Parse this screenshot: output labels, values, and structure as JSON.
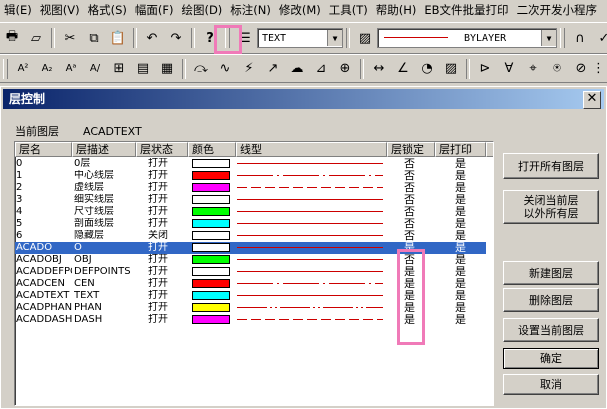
{
  "menubar": [
    "辑(E)",
    "视图(V)",
    "格式(S)",
    "幅面(F)",
    "绘图(D)",
    "标注(N)",
    "修改(M)",
    "工具(T)",
    "帮助(H)",
    "EB文件批量打印",
    "二次开发小程序"
  ],
  "toolbar1": {
    "layer_combo": "TEXT",
    "linetype_combo": "BYLAYER"
  },
  "dialog": {
    "title": "层控制",
    "current_layer_label": "当前图层",
    "current_layer_value": "ACADTEXT",
    "columns": [
      "层名",
      "层描述",
      "层状态",
      "颜色",
      "线型",
      "层锁定",
      "层打印"
    ],
    "rows": [
      {
        "name": "0",
        "desc": "0层",
        "state": "打开",
        "color": "#ffffff",
        "ltype": "solid",
        "lock": "否",
        "print": "是"
      },
      {
        "name": "1",
        "desc": "中心线层",
        "state": "打开",
        "color": "#ff0000",
        "ltype": "center",
        "lock": "否",
        "print": "是"
      },
      {
        "name": "2",
        "desc": "虚线层",
        "state": "打开",
        "color": "#ff00ff",
        "ltype": "dash",
        "lock": "否",
        "print": "是"
      },
      {
        "name": "3",
        "desc": "细实线层",
        "state": "打开",
        "color": "#ffffff",
        "ltype": "solid",
        "lock": "否",
        "print": "是"
      },
      {
        "name": "4",
        "desc": "尺寸线层",
        "state": "打开",
        "color": "#00ff00",
        "ltype": "solid",
        "lock": "否",
        "print": "是"
      },
      {
        "name": "5",
        "desc": "剖面线层",
        "state": "打开",
        "color": "#00ffff",
        "ltype": "solid",
        "lock": "否",
        "print": "是"
      },
      {
        "name": "6",
        "desc": "隐藏层",
        "state": "关闭",
        "color": "#ffffff",
        "ltype": "solid",
        "lock": "否",
        "print": "是"
      },
      {
        "name": "ACADO",
        "desc": "O",
        "state": "打开",
        "color": "#ffffff",
        "ltype": "solid",
        "lock": "是",
        "print": "是",
        "selected": true
      },
      {
        "name": "ACADOBJ",
        "desc": "OBJ",
        "state": "打开",
        "color": "#00ff00",
        "ltype": "solid",
        "lock": "否",
        "print": "是"
      },
      {
        "name": "ACADDEFPOI",
        "desc": "DEFPOINTS",
        "state": "打开",
        "color": "#ffffff",
        "ltype": "solid",
        "lock": "是",
        "print": "是"
      },
      {
        "name": "ACADCEN",
        "desc": "CEN",
        "state": "打开",
        "color": "#ff0000",
        "ltype": "center",
        "lock": "是",
        "print": "是"
      },
      {
        "name": "ACADTEXT",
        "desc": "TEXT",
        "state": "打开",
        "color": "#00ffff",
        "ltype": "solid",
        "lock": "是",
        "print": "是"
      },
      {
        "name": "ACADPHAN",
        "desc": "PHAN",
        "state": "打开",
        "color": "#ffff00",
        "ltype": "phantom",
        "lock": "是",
        "print": "是"
      },
      {
        "name": "ACADDASH",
        "desc": "DASH",
        "state": "打开",
        "color": "#ff00ff",
        "ltype": "dash",
        "lock": "是",
        "print": "是"
      }
    ],
    "buttons": {
      "open_all": "打开所有图层",
      "close_others": "关闭当前层\n以外所有层",
      "new_layer": "新建图层",
      "delete_layer": "删除图层",
      "set_current": "设置当前图层",
      "ok": "确定",
      "cancel": "取消"
    }
  },
  "colors": {
    "highlight": "#f07ab8",
    "selection": "#3167c5",
    "linetype": "#cc0000"
  }
}
